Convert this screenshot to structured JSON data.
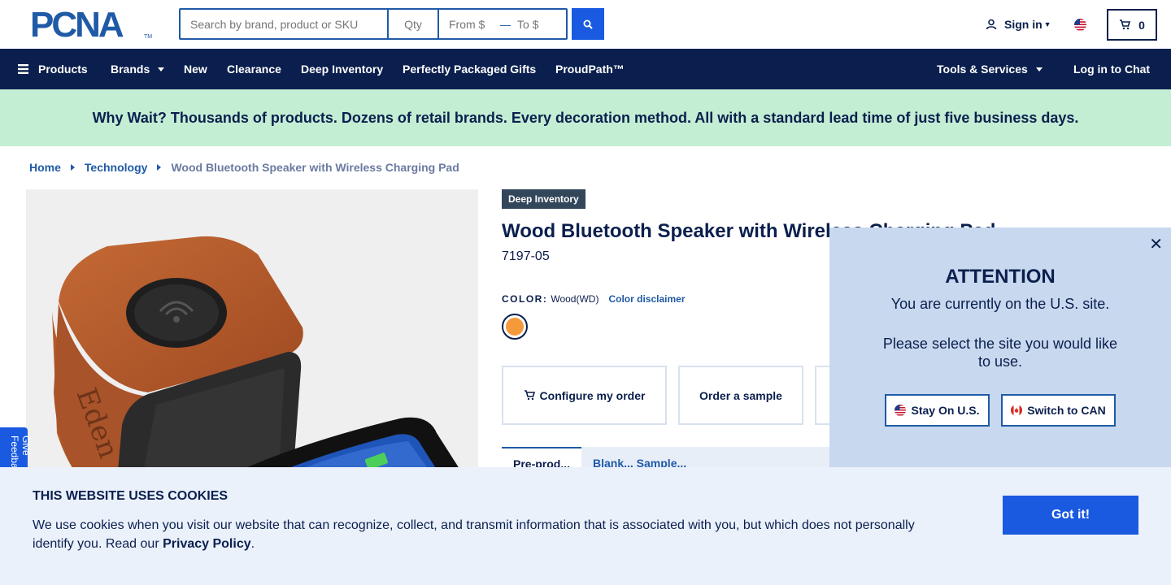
{
  "header": {
    "logo_text": "PCNA",
    "logo_tm": "TM",
    "search_placeholder": "Search by brand, product or SKU",
    "qty_placeholder": "Qty",
    "from_placeholder": "From $",
    "to_placeholder": "To $",
    "sign_in": "Sign in",
    "cart_count": "0"
  },
  "nav": {
    "products": "Products",
    "brands": "Brands",
    "new": "New",
    "clearance": "Clearance",
    "deep_inventory": "Deep Inventory",
    "gifts": "Perfectly Packaged Gifts",
    "proudpath": "ProudPath™",
    "tools": "Tools & Services",
    "chat": "Log in to Chat"
  },
  "banner": {
    "text": "Why Wait? Thousands of products. Dozens of retail brands. Every decoration method. All with a standard lead time of just five business days."
  },
  "breadcrumb": {
    "home": "Home",
    "category": "Technology",
    "current": "Wood Bluetooth Speaker with Wireless Charging Pad"
  },
  "product": {
    "badge": "Deep Inventory",
    "title": "Wood Bluetooth Speaker with Wireless Charging Pad",
    "sku": "7197-05",
    "color_label": "COLOR:",
    "color_value": "Wood(WD)",
    "color_disclaimer": "Color disclaimer",
    "swatch_color": "#f59a3b",
    "configure_label": "Configure my order",
    "sample_label": "Order a sample",
    "tab_active": "Pre-prod...",
    "tab_inactive": "Blank... Sample..."
  },
  "feedback": {
    "label": "Give Feedback"
  },
  "attention": {
    "title": "ATTENTION",
    "line1": "You are currently on the U.S. site.",
    "line2": "Please select the site you would like to use.",
    "stay_label": "Stay On U.S.",
    "switch_label": "Switch to CAN",
    "close": "✕"
  },
  "cookie": {
    "title": "THIS WEBSITE USES COOKIES",
    "text": "We use cookies when you visit our website that can recognize, collect, and transmit information that is associated with you, but which does not personally identify you. Read our ",
    "link": "Privacy Policy",
    "period": ".",
    "button": "Got it!"
  },
  "colors": {
    "navy": "#0b1f4e",
    "brand_blue": "#1f5aa6",
    "action_blue": "#1a5ae0",
    "banner_green": "#c3eed3",
    "popup_bg": "#c8d8ee",
    "cookie_bg": "#eaf1fb"
  }
}
